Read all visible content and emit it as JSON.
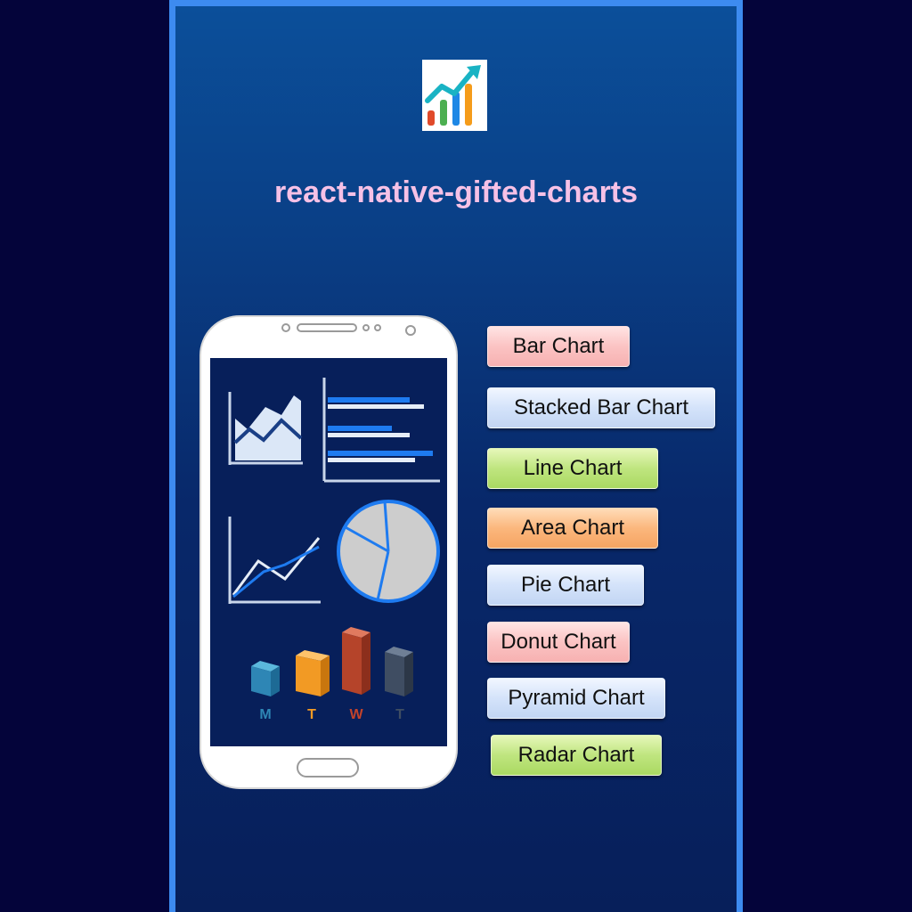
{
  "title": "react-native-gifted-charts",
  "menu": {
    "bar_chart": "Bar Chart",
    "stacked_bar_chart": "Stacked Bar Chart",
    "line_chart": "Line Chart",
    "area_chart": "Area Chart",
    "pie_chart": "Pie Chart",
    "donut_chart": "Donut Chart",
    "pyramid_chart": "Pyramid Chart",
    "radar_chart": "Radar Chart"
  },
  "illustration": {
    "day_labels": [
      "M",
      "T",
      "W",
      "T"
    ]
  },
  "colors": {
    "background": "#04043a",
    "frame_border": "#3d8bf0",
    "title": "#f6c1e6"
  }
}
